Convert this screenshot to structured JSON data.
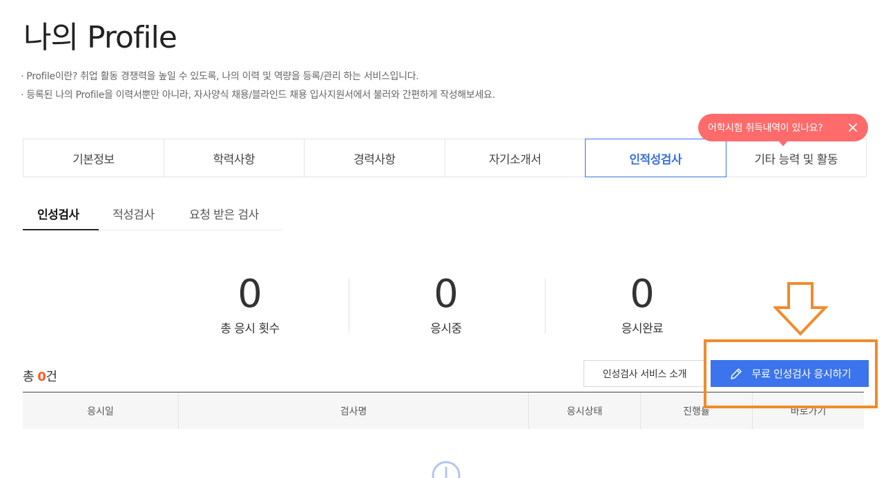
{
  "header": {
    "title": "나의 Profile",
    "desc1": "· Profile이란? 취업 활동 경쟁력을 높일 수 있도록, 나의 이력 및 역량을 등록/관리 하는 서비스입니다.",
    "desc2": "· 등록된 나의 Profile을 이력서뿐만 아니라, 자사양식 채용/블라인드 채용 입사지원서에서 불러와 간편하게 작성해보세요."
  },
  "tooltip": {
    "text": "어학시험 취득내역이 있나요?",
    "icon": "close-icon"
  },
  "main_tabs": [
    {
      "label": "기본정보"
    },
    {
      "label": "학력사항"
    },
    {
      "label": "경력사항"
    },
    {
      "label": "자기소개서"
    },
    {
      "label": "인적성검사"
    },
    {
      "label": "기타 능력 및 활동"
    }
  ],
  "active_main_tab": "인적성검사",
  "sub_tabs": [
    {
      "label": "인성검사"
    },
    {
      "label": "적성검사"
    },
    {
      "label": "요청 받은 검사"
    }
  ],
  "active_sub_tab": "인성검사",
  "stats": [
    {
      "value": "0",
      "label": "총 응시 횟수"
    },
    {
      "value": "0",
      "label": "응시중"
    },
    {
      "value": "0",
      "label": "응시완료"
    }
  ],
  "list": {
    "total_prefix": "총 ",
    "total_count": "0",
    "total_suffix": "건"
  },
  "buttons": {
    "intro_label": "인성검사 서비스 소개",
    "apply_label": "무료 인성검사 응시하기",
    "apply_icon": "pencil-icon"
  },
  "table": {
    "headers": [
      "응시일",
      "검사명",
      "응시상태",
      "진행률",
      "바로가기"
    ]
  },
  "annotation": {
    "arrow_icon": "down-arrow-icon",
    "color": "#f28a2a"
  },
  "colors": {
    "accent": "#3b74ec",
    "tooltip": "#ff6b6b",
    "count": "#ff5a1f"
  }
}
